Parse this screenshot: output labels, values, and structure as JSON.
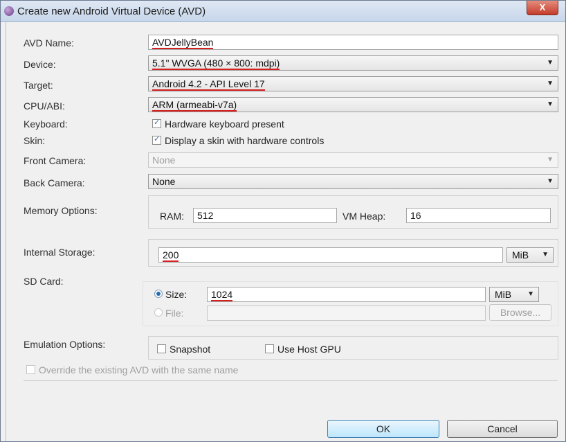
{
  "window": {
    "title": "Create new Android Virtual Device (AVD)",
    "close_glyph": "X"
  },
  "labels": {
    "avd_name": "AVD Name:",
    "device": "Device:",
    "target": "Target:",
    "cpu_abi": "CPU/ABI:",
    "keyboard": "Keyboard:",
    "skin": "Skin:",
    "front_camera": "Front Camera:",
    "back_camera": "Back Camera:",
    "memory_options": "Memory Options:",
    "internal_storage": "Internal Storage:",
    "sd_card": "SD Card:",
    "emulation_options": "Emulation Options:"
  },
  "fields": {
    "avd_name": "AVDJellyBean",
    "device": "5.1\" WVGA (480 × 800: mdpi)",
    "target": "Android 4.2 - API Level 17",
    "cpu_abi": "ARM (armeabi-v7a)",
    "front_camera": "None",
    "back_camera": "None"
  },
  "checkboxes": {
    "keyboard": "Hardware keyboard present",
    "skin": "Display a skin with hardware controls",
    "snapshot": "Snapshot",
    "use_host_gpu": "Use Host GPU",
    "override": "Override the existing AVD with the same name"
  },
  "memory": {
    "ram_label": "RAM:",
    "ram_value": "512",
    "vm_heap_label": "VM Heap:",
    "vm_heap_value": "16"
  },
  "internal_storage": {
    "value": "200",
    "unit": "MiB"
  },
  "sd_card": {
    "size_label": "Size:",
    "size_value": "1024",
    "size_unit": "MiB",
    "file_label": "File:",
    "browse": "Browse..."
  },
  "buttons": {
    "ok": "OK",
    "cancel": "Cancel"
  },
  "colors": {
    "underline": "#d62020"
  }
}
